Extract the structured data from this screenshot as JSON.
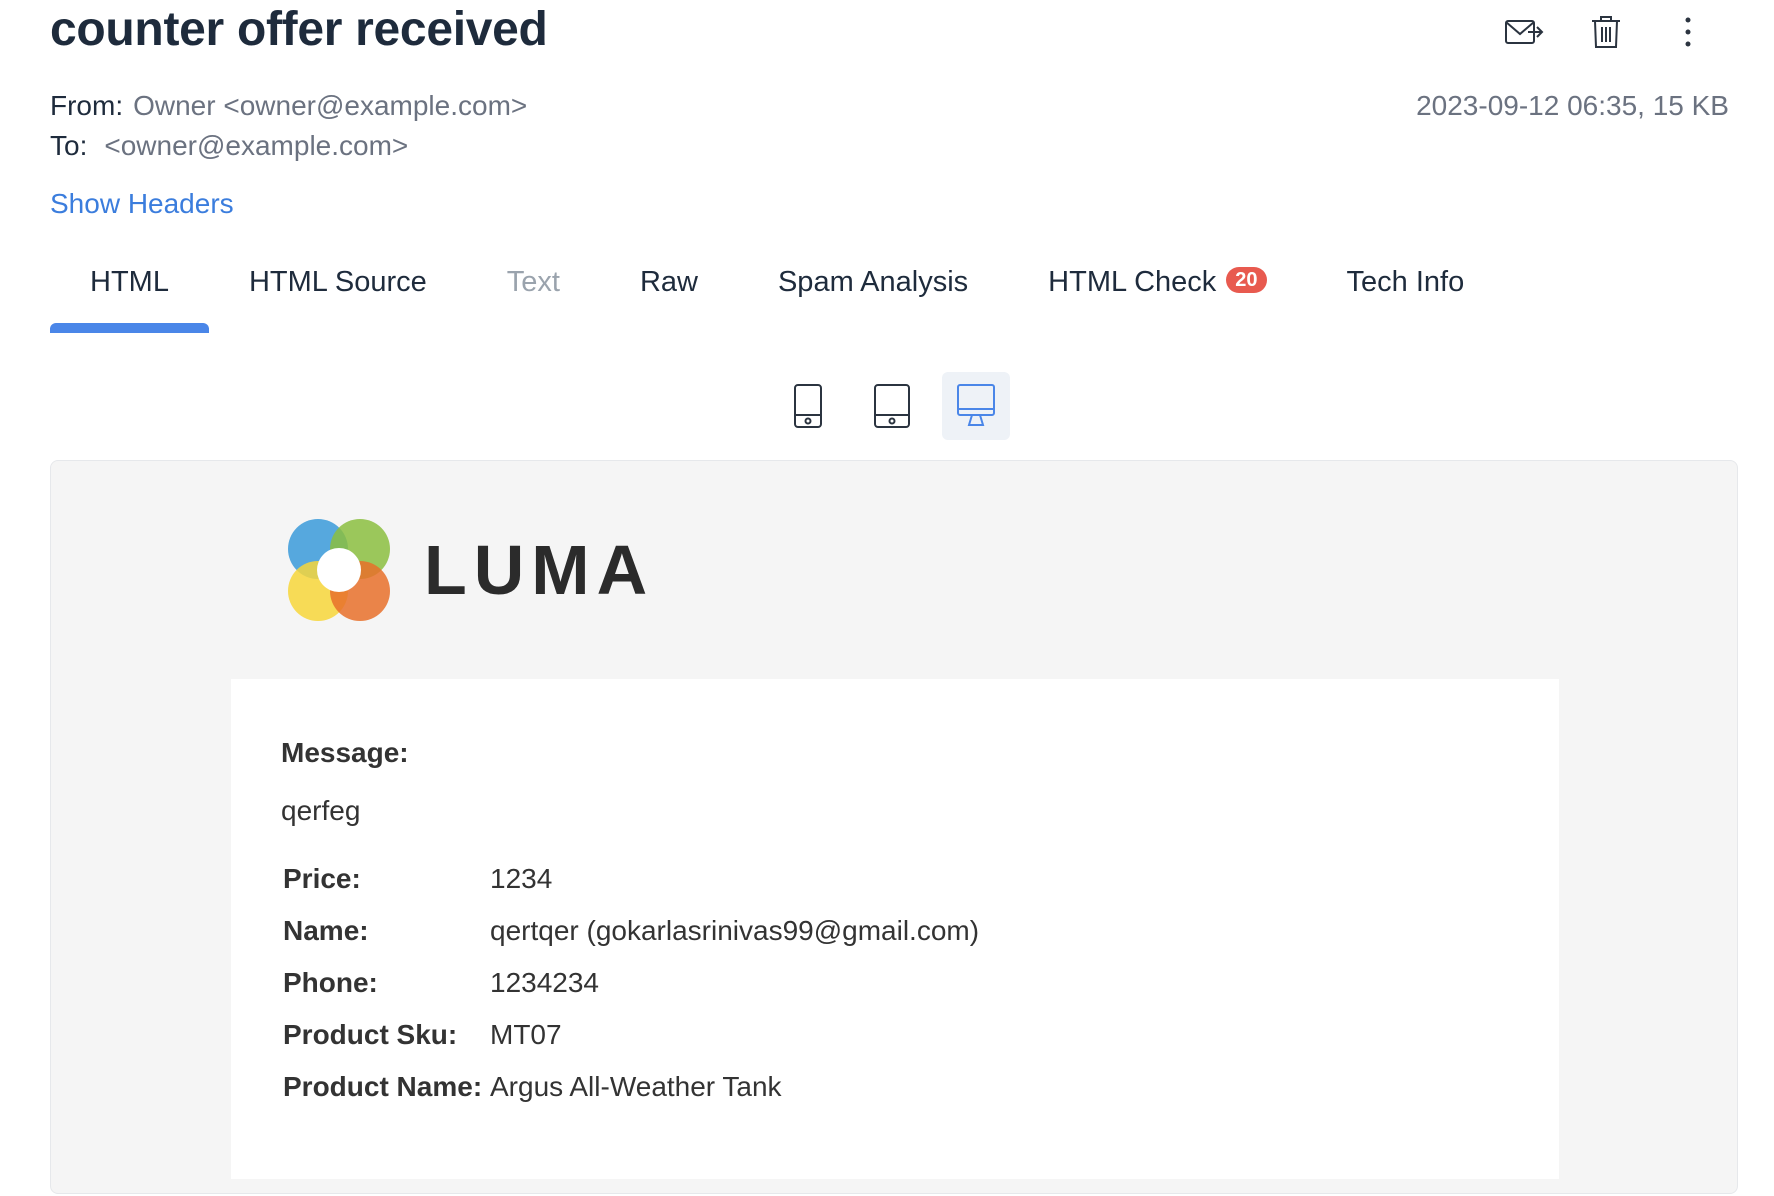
{
  "email": {
    "subject": "counter offer received",
    "from_label": "From:",
    "from_value": "Owner <owner@example.com>",
    "to_label": "To:",
    "to_value": "<owner@example.com>",
    "date_size": "2023-09-12 06:35, 15 KB",
    "show_headers": "Show Headers"
  },
  "actions": [
    {
      "icon": "forward-mail-icon"
    },
    {
      "icon": "trash-icon"
    },
    {
      "icon": "more-vertical-icon"
    }
  ],
  "tabs": [
    {
      "label": "HTML",
      "active": true
    },
    {
      "label": "HTML Source"
    },
    {
      "label": "Text",
      "disabled": true
    },
    {
      "label": "Raw"
    },
    {
      "label": "Spam Analysis"
    },
    {
      "label": "HTML Check",
      "badge": "20"
    },
    {
      "label": "Tech Info"
    }
  ],
  "devices": [
    {
      "icon": "mobile-icon"
    },
    {
      "icon": "tablet-icon"
    },
    {
      "icon": "desktop-icon",
      "active": true
    }
  ],
  "preview": {
    "logo_text": "LUMA",
    "message_label": "Message:",
    "message_text": "qerfeg",
    "details": [
      {
        "label": "Price:",
        "value": "1234"
      },
      {
        "label": "Name:",
        "value": "qertqer (gokarlasrinivas99@gmail.com)"
      },
      {
        "label": "Phone:",
        "value": "1234234"
      },
      {
        "label": "Product Sku:",
        "value": "MT07"
      },
      {
        "label": "Product Name:",
        "value": "Argus All-Weather Tank"
      }
    ]
  },
  "colors": {
    "accent": "#4a86e8",
    "badge": "#e85a4f",
    "link": "#3b7ddd"
  }
}
